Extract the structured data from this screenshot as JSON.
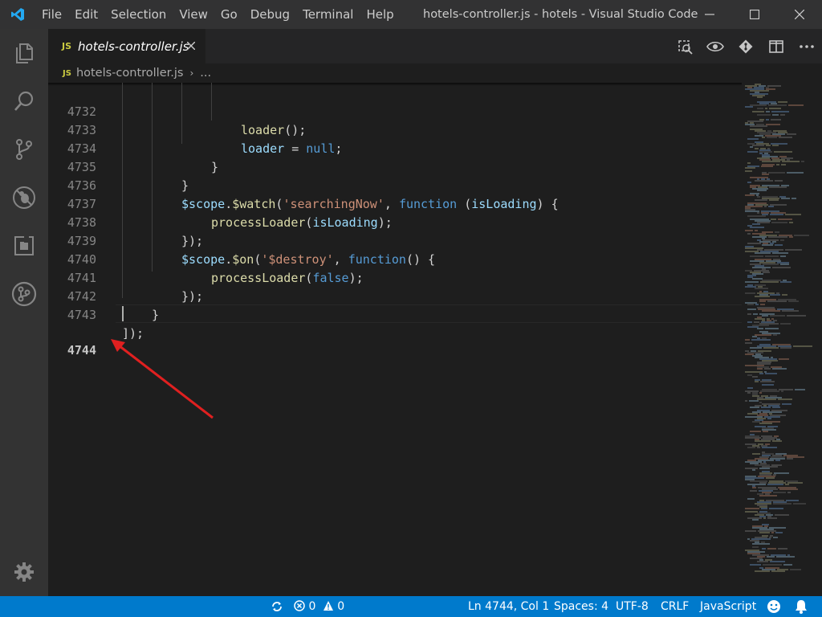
{
  "app": {
    "window_title": "hotels-controller.js - hotels - Visual Studio Code"
  },
  "menu": [
    {
      "id": "file",
      "label": "File"
    },
    {
      "id": "edit",
      "label": "Edit"
    },
    {
      "id": "selection",
      "label": "Selection"
    },
    {
      "id": "view",
      "label": "View"
    },
    {
      "id": "go",
      "label": "Go"
    },
    {
      "id": "debug",
      "label": "Debug"
    },
    {
      "id": "terminal",
      "label": "Terminal"
    },
    {
      "id": "help",
      "label": "Help"
    }
  ],
  "activity_bar": [
    {
      "name": "explorer-icon"
    },
    {
      "name": "search-icon"
    },
    {
      "name": "source-control-icon"
    },
    {
      "name": "debug-icon"
    },
    {
      "name": "extensions-icon"
    },
    {
      "name": "gitlens-icon"
    },
    {
      "name": "settings-gear-icon"
    }
  ],
  "tab": {
    "badge": "JS",
    "label": "hotels-controller.js"
  },
  "breadcrumb": {
    "badge": "JS",
    "file": "hotels-controller.js",
    "ellipsis": "..."
  },
  "editor": {
    "lines": [
      {
        "n": "4732",
        "text": "loader();"
      },
      {
        "n": "4733",
        "text": "loader = null;"
      },
      {
        "n": "4734",
        "text": "}"
      },
      {
        "n": "4735",
        "text": "}"
      },
      {
        "n": "4736",
        "text": "$scope.$watch('searchingNow', function (isLoading) {"
      },
      {
        "n": "4737",
        "text": "processLoader(isLoading);"
      },
      {
        "n": "4738",
        "text": "});"
      },
      {
        "n": "4739",
        "text": "$scope.$on('$destroy', function() {"
      },
      {
        "n": "4740",
        "text": "processLoader(false);"
      },
      {
        "n": "4741",
        "text": "});"
      },
      {
        "n": "4742",
        "text": "}"
      },
      {
        "n": "4743",
        "text": "]);"
      },
      {
        "n": "4744",
        "text": ""
      }
    ],
    "active_line": "4744"
  },
  "status_bar": {
    "errors": "0",
    "warnings": "0",
    "position": "Ln 4744, Col 1",
    "spaces": "Spaces: 4",
    "encoding": "UTF-8",
    "eol": "CRLF",
    "language": "JavaScript"
  },
  "colors": {
    "accent": "#007acc",
    "arrow": "#e02020"
  }
}
